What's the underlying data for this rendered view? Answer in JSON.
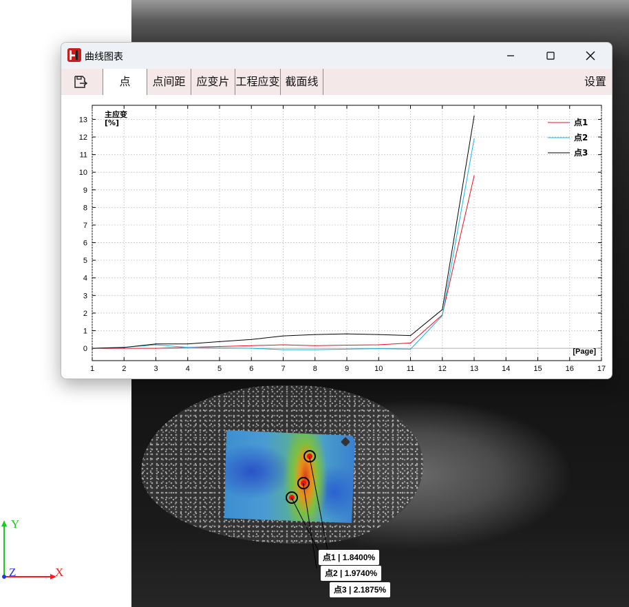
{
  "window": {
    "title": "曲线图表",
    "controls": [
      "minimize-icon",
      "maximize-icon",
      "close-icon"
    ]
  },
  "tabs": [
    {
      "label": "点",
      "active": true
    },
    {
      "label": "点间距",
      "active": false
    },
    {
      "label": "应变片",
      "active": false
    },
    {
      "label": "工程应变",
      "active": false
    },
    {
      "label": "截面线",
      "active": false
    }
  ],
  "toolbar": {
    "save_icon": "export-icon",
    "settings_label": "设置"
  },
  "chart_data": {
    "type": "line",
    "ylabel": "主应变",
    "yunit": "[%]",
    "xlabel": "[Page]",
    "xlim": [
      1,
      17
    ],
    "ylim": [
      -0.7,
      13.8
    ],
    "xticks": [
      1,
      2,
      3,
      4,
      5,
      6,
      7,
      8,
      9,
      10,
      11,
      12,
      13,
      14,
      15,
      16,
      17
    ],
    "yticks": [
      0,
      1,
      2,
      3,
      4,
      5,
      6,
      7,
      8,
      9,
      10,
      11,
      12,
      13
    ],
    "grid": true,
    "legend_position": "top-right",
    "x": [
      1,
      2,
      3,
      4,
      5,
      6,
      7,
      8,
      9,
      10,
      11,
      12,
      13
    ],
    "series": [
      {
        "name": "点1",
        "color": "#e8101c",
        "values": [
          0,
          0,
          0,
          0.05,
          0.1,
          0.15,
          0.2,
          0.15,
          0.18,
          0.2,
          0.3,
          1.9,
          9.8
        ]
      },
      {
        "name": "点2",
        "color": "#14b4e6",
        "values": [
          0,
          0.05,
          0.2,
          0.05,
          0.03,
          0,
          -0.08,
          -0.08,
          -0.05,
          -0.02,
          -0.05,
          1.85,
          11.9
        ]
      },
      {
        "name": "点3",
        "color": "#000000",
        "values": [
          0,
          0.05,
          0.25,
          0.25,
          0.38,
          0.5,
          0.7,
          0.78,
          0.82,
          0.78,
          0.72,
          2.2,
          13.2
        ]
      }
    ]
  },
  "overlay": {
    "points": [
      {
        "label": "点1 | 1.8400%"
      },
      {
        "label": "点2 | 1.9740%"
      },
      {
        "label": "点3 | 2.1875%"
      }
    ]
  },
  "axis_triad": {
    "x": "X",
    "y": "Y",
    "z": "Z",
    "x_color": "#ff1a1a",
    "y_color": "#1acc1a",
    "z_color": "#2233ee"
  }
}
